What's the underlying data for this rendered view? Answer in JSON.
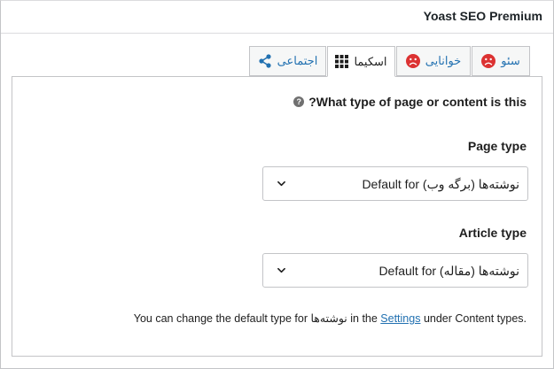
{
  "panel": {
    "title": "Yoast SEO Premium"
  },
  "tabs": [
    {
      "label": "سئو",
      "icon": "sad-face-icon",
      "status_color": "#dc3232"
    },
    {
      "label": "خوانایی",
      "icon": "sad-face-icon",
      "status_color": "#dc3232"
    },
    {
      "label": "اسکیما",
      "icon": "grid-icon",
      "active": true
    },
    {
      "label": "اجتماعی",
      "icon": "share-icon"
    }
  ],
  "schema": {
    "question": "?What type of page or content is this",
    "page_type": {
      "label": "Page type",
      "value": "Default for نوشته‌ها (برگه وب)"
    },
    "article_type": {
      "label": "Article type",
      "value": "Default for نوشته‌ها (مقاله)"
    },
    "footer": {
      "before": "You can change the default type for نوشته‌ها in the ",
      "link": "Settings",
      "after": " under Content types."
    }
  },
  "colors": {
    "link": "#2271b1",
    "error": "#dc3232",
    "border": "#c3c4c7"
  }
}
